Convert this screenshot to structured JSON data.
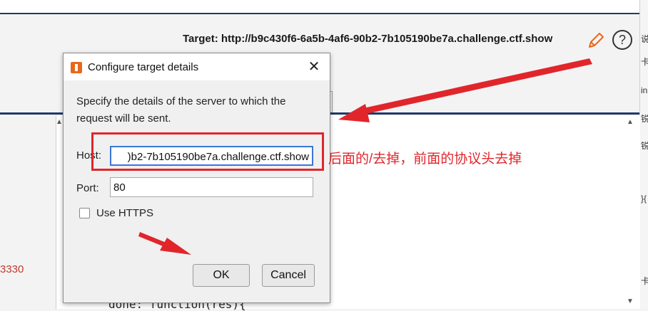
{
  "toolbar": {
    "target_text": "Target: http://b9c430f6-6a5b-4af6-90b2-7b105190be7a.challenge.ctf.show",
    "help_symbol": "?"
  },
  "background": {
    "left_code_fragment": "3330",
    "code_line": "done: function(res){",
    "right_edge_chars": [
      "说",
      "卡",
      "in",
      "锐",
      "锐",
      "}{",
      "卡"
    ]
  },
  "dialog": {
    "title": "Configure target details",
    "close_symbol": "✕",
    "description": "Specify the details of the server to which the request will be sent.",
    "host_label": "Host:",
    "host_value": ")b2-7b105190be7a.challenge.ctf.show",
    "port_label": "Port:",
    "port_value": "80",
    "https_label": "Use HTTPS",
    "https_checked": false,
    "ok_label": "OK",
    "cancel_label": "Cancel"
  },
  "annotation": {
    "text": "后面的/去掉，前面的协议头去掉",
    "color": "#e0262b"
  },
  "icons": {
    "edit": "pencil-icon",
    "help": "help-circle-icon",
    "logo": "burp-logo-icon",
    "close": "close-icon"
  }
}
